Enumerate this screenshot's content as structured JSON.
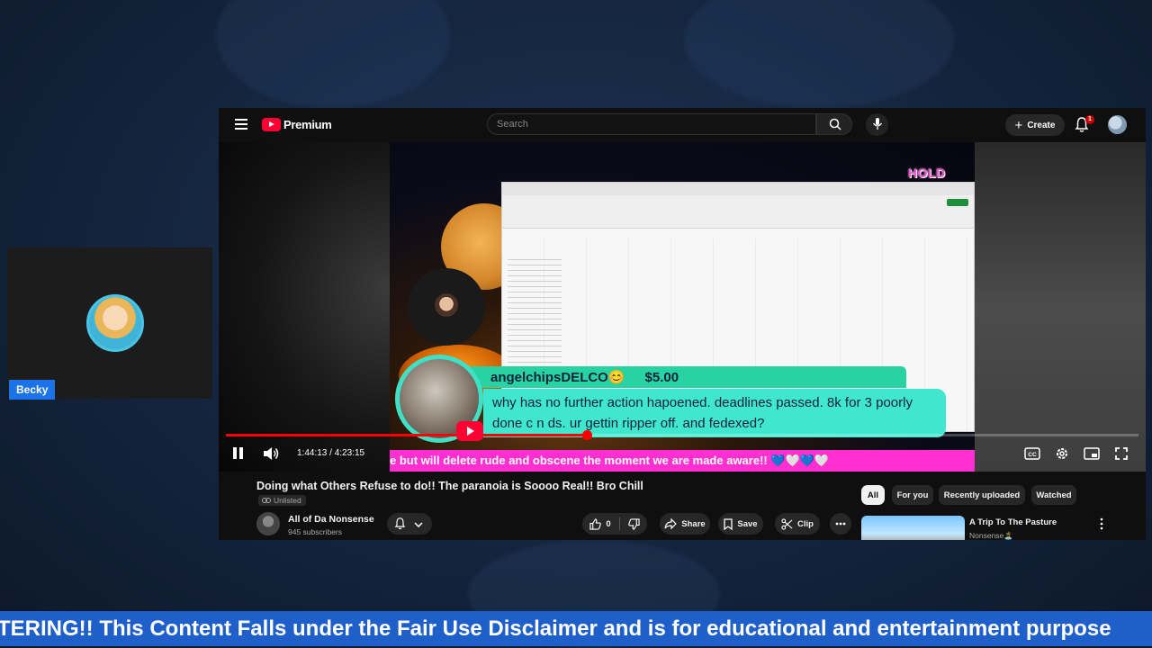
{
  "background": {
    "color": "#14243d"
  },
  "cam": {
    "name_tag": "Becky"
  },
  "header": {
    "logo_text": "Premium",
    "search_placeholder": "Search",
    "create_label": "Create",
    "notification_count": "1"
  },
  "player": {
    "overlay_badge": "HOLD",
    "donation": {
      "username": "angelchipsDELCO😊",
      "amount": "$5.00",
      "message": "why has no further action hapoened. deadlines passed. 8k for 3 poorly done c n ds. ur gettin ripper off. and fedexed?"
    },
    "ticker": "e but will delete rude and obscene the moment we are made aware!! 💙🤍💙🤍",
    "time_current": "1:44:13",
    "time_total": "4:23:15",
    "time_display": "1:44:13 / 4:23:15",
    "progress": 0.395
  },
  "video": {
    "title": "Doing what Others Refuse to do!! The paranoia is Soooo Real!! Bro Chill",
    "visibility": "Unlisted",
    "channel_name": "All of Da Nonsense",
    "subscribers": "945 subscribers",
    "like_count": "0",
    "share_label": "Share",
    "save_label": "Save",
    "clip_label": "Clip"
  },
  "chips": [
    "All",
    "For you",
    "Recently uploaded",
    "Watched"
  ],
  "recommendation": {
    "title": "A Trip To The Pasture",
    "channel": "Nonsense🏝️"
  },
  "banner": {
    "text": "TERING!! This Content Falls under the Fair Use Disclaimer and is for educational and entertainment purpose"
  },
  "colors": {
    "accent": "#ff0033",
    "ticker": "#ff2fd2",
    "donation": "#3fe7cf",
    "banner": "#1f5fc9"
  }
}
